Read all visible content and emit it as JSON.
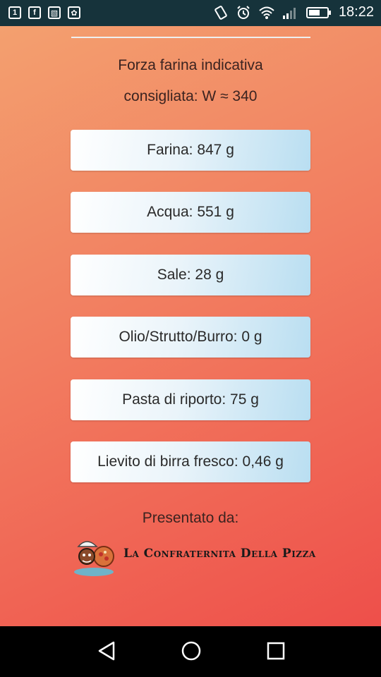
{
  "status_bar": {
    "left_icons": [
      "notification-1-icon",
      "facebook-icon",
      "gallery-icon",
      "app-icon"
    ],
    "left_glyphs": [
      "1",
      "f",
      "▧",
      "✿"
    ],
    "right_icons": [
      "vibrate-icon",
      "alarm-icon",
      "wifi-icon",
      "signal-icon",
      "battery-icon"
    ],
    "time": "18:22"
  },
  "strength": {
    "line1": "Forza farina indicativa",
    "line2": "consigliata: W ≈ 340"
  },
  "results": [
    {
      "label": "Farina: 847 g"
    },
    {
      "label": "Acqua: 551 g"
    },
    {
      "label": "Sale: 28 g"
    },
    {
      "label": "Olio/Strutto/Burro: 0 g"
    },
    {
      "label": "Pasta di riporto: 75 g"
    },
    {
      "label": "Lievito di birra fresco: 0,46 g"
    }
  ],
  "footer": {
    "presented_by": "Presentato da:",
    "logo_text": "La Confraternita Della Pizza"
  },
  "nav_bar": {
    "buttons": [
      "back-icon",
      "home-icon",
      "recents-icon"
    ]
  },
  "colors": {
    "status_bar": "#16333b",
    "gradient_start": "#f3a06f",
    "gradient_end": "#ee4f4a",
    "button_start": "#ffffff",
    "button_end": "#b9def1"
  }
}
